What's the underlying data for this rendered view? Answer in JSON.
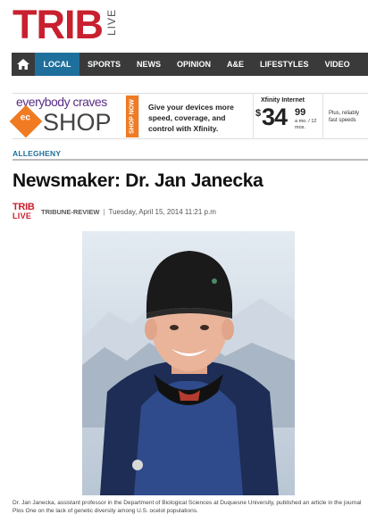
{
  "header": {
    "logo_text": "TRIB",
    "logo_sub": "LIVE",
    "brand_color": "#c8202f"
  },
  "nav": {
    "home_icon": "home-icon",
    "items": [
      {
        "label": "LOCAL",
        "active": true
      },
      {
        "label": "SPORTS",
        "active": false
      },
      {
        "label": "NEWS",
        "active": false
      },
      {
        "label": "OPINION",
        "active": false
      },
      {
        "label": "A&E",
        "active": false
      },
      {
        "label": "LIFESTYLES",
        "active": false
      },
      {
        "label": "VIDEO",
        "active": false
      }
    ],
    "bg_color": "#3a3a3a",
    "active_color": "#1f6f9c"
  },
  "ad": {
    "tagline": "everybody craves",
    "logo_mark": "ec",
    "shop": "SHOP",
    "shop_now": "SHOP NOW",
    "message": "Give your devices more speed, coverage, and control with Xfinity.",
    "product": "Xfinity Internet",
    "currency": "$",
    "price_whole": "34",
    "price_cents": "99",
    "price_term": "a mo. / 12 mos.",
    "right_text": "Plus, reliably fast speeds"
  },
  "article": {
    "section": "ALLEGHENY",
    "headline": "Newsmaker: Dr. Jan Janecka",
    "byline_logo_top": "TRIB",
    "byline_logo_bottom": "LIVE",
    "source": "TRIBUNE-REVIEW",
    "separator": "|",
    "date": "Tuesday, April 15, 2014 11:21 p.m",
    "caption": "Dr. Jan Janecka, assistant professor in the Department of Biological Sciences at Duquesne University, published an article in the journal Plos One on the lack of genetic diversity among U.S. ocelot populations."
  }
}
